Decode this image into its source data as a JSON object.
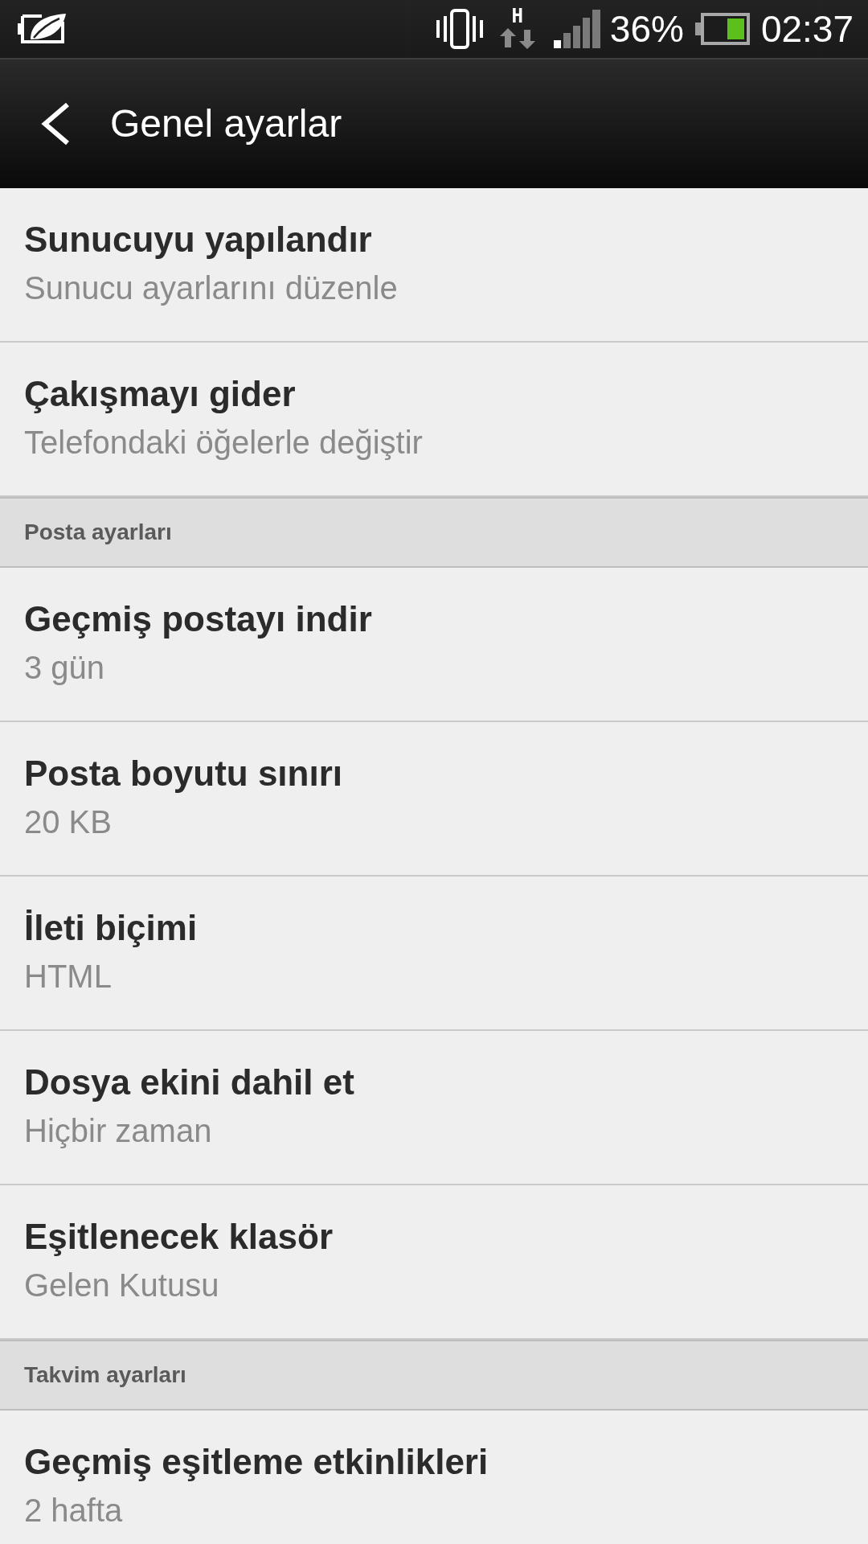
{
  "status_bar": {
    "network_type": "H",
    "battery_percent": "36%",
    "time": "02:37"
  },
  "action_bar": {
    "title": "Genel ayarlar"
  },
  "sections": [
    {
      "items": [
        {
          "title": "Sunucuyu yapılandır",
          "summary": "Sunucu ayarlarını düzenle"
        },
        {
          "title": "Çakışmayı gider",
          "summary": "Telefondaki öğelerle değiştir"
        }
      ]
    },
    {
      "header": "Posta ayarları",
      "items": [
        {
          "title": "Geçmiş postayı indir",
          "summary": "3 gün"
        },
        {
          "title": "Posta boyutu sınırı",
          "summary": "20 KB"
        },
        {
          "title": "İleti biçimi",
          "summary": "HTML"
        },
        {
          "title": "Dosya ekini dahil et",
          "summary": "Hiçbir zaman"
        },
        {
          "title": "Eşitlenecek klasör",
          "summary": "Gelen Kutusu"
        }
      ]
    },
    {
      "header": "Takvim ayarları",
      "items": [
        {
          "title": "Geçmiş eşitleme etkinlikleri",
          "summary": "2 hafta"
        }
      ]
    }
  ]
}
